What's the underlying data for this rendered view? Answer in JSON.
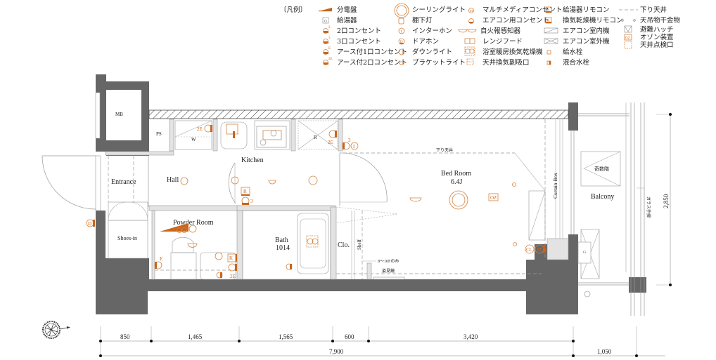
{
  "legend": {
    "title": "〔凡例〕",
    "col1": [
      {
        "icon": "distribution-board-icon",
        "label": "分電盤"
      },
      {
        "icon": "water-heater-icon",
        "label": "給湯器",
        "glyph": "G"
      },
      {
        "icon": "outlet-2-icon",
        "label": "2口コンセント",
        "sup": "2"
      },
      {
        "icon": "outlet-3-icon",
        "label": "3口コンセント",
        "sup": "3"
      },
      {
        "icon": "outlet-earth-1-icon",
        "label": "アース付1口コンセント",
        "sup": "E"
      },
      {
        "icon": "outlet-earth-2-icon",
        "label": "アース付2口コンセント",
        "sup": "2E"
      }
    ],
    "col2": [
      {
        "icon": "ceiling-light-icon",
        "label": "シーリングライト"
      },
      {
        "icon": "under-cabinet-light-icon",
        "label": "棚下灯"
      },
      {
        "icon": "intercom-icon",
        "label": "インターホン",
        "glyph": "I"
      },
      {
        "icon": "door-phone-icon",
        "label": "ドアホン",
        "glyph": "D"
      },
      {
        "icon": "downlight-icon",
        "label": "ダウンライト"
      },
      {
        "icon": "bracket-light-icon",
        "label": "ブラケットライト"
      }
    ],
    "col3": [
      {
        "icon": "multimedia-outlet-icon",
        "label": "マルチメディアコンセント",
        "glyph": "M"
      },
      {
        "icon": "aircon-outlet-icon",
        "label": "エアコン用コンセント"
      },
      {
        "icon": "fire-detector-icon",
        "label": "自火報感知器"
      },
      {
        "icon": "range-hood-icon",
        "label": "レンジフード"
      },
      {
        "icon": "bath-dryer-icon",
        "label": "浴室暖房換気乾燥機"
      },
      {
        "icon": "ceiling-vent-icon",
        "label": "天井換気副吸口"
      }
    ],
    "col4": [
      {
        "icon": "water-heater-remote-icon",
        "label": "給湯器リモコン",
        "glyph": "R"
      },
      {
        "icon": "dryer-remote-icon",
        "label": "換気乾燥機リモコン",
        "glyph": "K"
      },
      {
        "icon": "aircon-indoor-icon",
        "label": "エアコン室内機"
      },
      {
        "icon": "aircon-outdoor-icon",
        "label": "エアコン室外機"
      },
      {
        "icon": "water-tap-icon",
        "label": "給水栓"
      },
      {
        "icon": "mixing-tap-icon",
        "label": "混合水栓"
      }
    ],
    "col5": [
      {
        "icon": "dropped-ceiling-icon",
        "label": "下り天井"
      },
      {
        "icon": "ceiling-hanger-icon",
        "label": "天吊物干金物"
      },
      {
        "icon": "escape-hatch-icon",
        "label": "避難ハッチ"
      },
      {
        "icon": "ozone-device-icon",
        "label": "オゾン装置",
        "glyph": "OZ"
      },
      {
        "icon": "ceiling-inspection-icon",
        "label": "天井点検口"
      }
    ]
  },
  "rooms": {
    "mb": "MB",
    "ps": "PS",
    "w": "W",
    "r": "R",
    "kitchen": "Kitchen",
    "entrance": "Entrance",
    "hall": "Hall",
    "shoes_in": "Shoes-in",
    "powder_room": "Powder Room",
    "bath": "Bath",
    "bath_size": "1014",
    "clo": "Clo.",
    "shelf": "Shelf",
    "bed_room": "Bed Room",
    "bed_room_size": "6.4J",
    "balcony": "Balcony",
    "curtain_box": "Curtain Box",
    "dropped_ceiling": "下り天井",
    "escape_stairs": "奇数階",
    "glass_rail": "ガラス手摺",
    "floors_note": "8～10Fのみ",
    "mirror": "姿見鏡"
  },
  "markers": {
    "outlet_2e": "2E",
    "outlet_3": "3",
    "outlet_e": "E",
    "intercom": "I",
    "door_phone": "D",
    "remote_r": "R",
    "remote_k": "K",
    "ozone": "OZ",
    "cl": "CL",
    "multimedia": "M",
    "water_heater": "G"
  },
  "dimensions": {
    "bottom": [
      "850",
      "1,465",
      "1,565",
      "600",
      "3,420"
    ],
    "total": "7,900",
    "balcony_depth": "1,050",
    "height": "2,850"
  },
  "colors": {
    "wall": "#666666",
    "light_wall": "#e3e3e3",
    "accent": "#c8661c",
    "accent_line": "#d4823f"
  }
}
